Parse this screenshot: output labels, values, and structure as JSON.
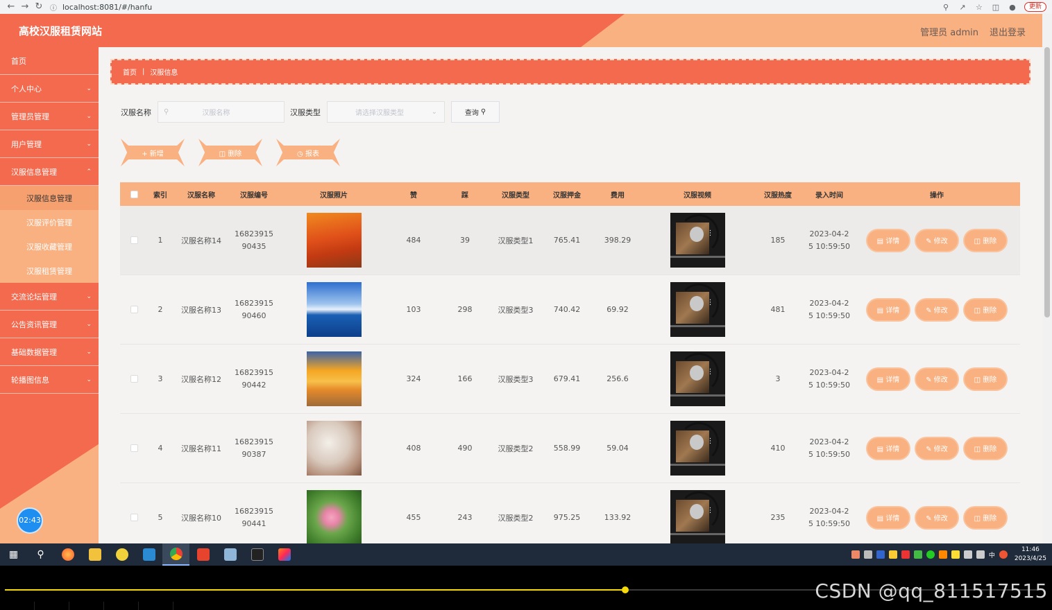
{
  "browser": {
    "url": "localhost:8081/#/hanfu",
    "update_label": "更新"
  },
  "header": {
    "title": "高校汉服租赁网站",
    "user": "管理员 admin",
    "logout": "退出登录"
  },
  "sidebar": {
    "items": [
      {
        "label": "首页"
      },
      {
        "label": "个人中心"
      },
      {
        "label": "管理员管理"
      },
      {
        "label": "用户管理"
      },
      {
        "label": "汉服信息管理"
      }
    ],
    "sub_items": [
      {
        "label": "汉服信息管理"
      },
      {
        "label": "汉服评价管理"
      },
      {
        "label": "汉服收藏管理"
      },
      {
        "label": "汉服租赁管理"
      }
    ],
    "items_after": [
      {
        "label": "交流论坛管理"
      },
      {
        "label": "公告资讯管理"
      },
      {
        "label": "基础数据管理"
      },
      {
        "label": "轮播图信息"
      }
    ],
    "clock": "02:43"
  },
  "breadcrumb": {
    "home": "首页",
    "current": "汉服信息"
  },
  "search": {
    "name_label": "汉服名称",
    "name_placeholder": "汉服名称",
    "type_label": "汉服类型",
    "type_placeholder": "请选择汉服类型",
    "query_label": "查询"
  },
  "actions": {
    "add": "新增",
    "delete": "删除",
    "report": "报表"
  },
  "table": {
    "headers": {
      "index": "索引",
      "name": "汉服名称",
      "code": "汉服编号",
      "photo": "汉服照片",
      "zan": "赞",
      "cai": "踩",
      "type": "汉服类型",
      "deposit": "汉服押金",
      "fee": "费用",
      "video": "汉服视频",
      "heat": "汉服热度",
      "time": "录入时间",
      "ops": "操作"
    },
    "op_labels": {
      "detail": "详情",
      "edit": "修改",
      "delete": "删除"
    },
    "rows": [
      {
        "index": "1",
        "name": "汉服名称14",
        "code1": "16823915",
        "code2": "90435",
        "zan": "484",
        "cai": "39",
        "type": "汉服类型1",
        "deposit": "765.41",
        "fee": "398.29",
        "heat": "185",
        "time1": "2023-04-2",
        "time2": "5 10:59:50"
      },
      {
        "index": "2",
        "name": "汉服名称13",
        "code1": "16823915",
        "code2": "90460",
        "zan": "103",
        "cai": "298",
        "type": "汉服类型3",
        "deposit": "740.42",
        "fee": "69.92",
        "heat": "481",
        "time1": "2023-04-2",
        "time2": "5 10:59:50"
      },
      {
        "index": "3",
        "name": "汉服名称12",
        "code1": "16823915",
        "code2": "90442",
        "zan": "324",
        "cai": "166",
        "type": "汉服类型3",
        "deposit": "679.41",
        "fee": "256.6",
        "heat": "3",
        "time1": "2023-04-2",
        "time2": "5 10:59:50"
      },
      {
        "index": "4",
        "name": "汉服名称11",
        "code1": "16823915",
        "code2": "90387",
        "zan": "408",
        "cai": "490",
        "type": "汉服类型2",
        "deposit": "558.99",
        "fee": "59.04",
        "heat": "410",
        "time1": "2023-04-2",
        "time2": "5 10:59:50"
      },
      {
        "index": "5",
        "name": "汉服名称10",
        "code1": "16823915",
        "code2": "90441",
        "zan": "455",
        "cai": "243",
        "type": "汉服类型2",
        "deposit": "975.25",
        "fee": "133.92",
        "heat": "235",
        "time1": "2023-04-2",
        "time2": "5 10:59:50"
      }
    ]
  },
  "taskbar": {
    "time": "11:46",
    "date": "2023/4/25",
    "ime": "中"
  },
  "player": {
    "watermark": "CSDN @qq_811517515"
  },
  "colors": {
    "primary_red": "#f36a4e",
    "accent_orange": "#f9b181"
  }
}
